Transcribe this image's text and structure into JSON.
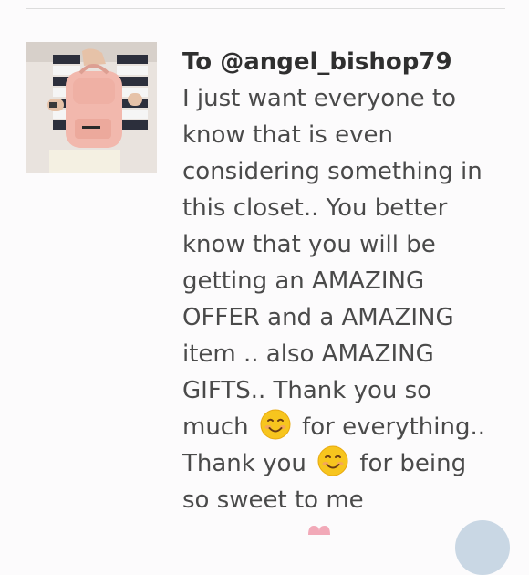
{
  "comment": {
    "author": "To @angel_bishop79",
    "lines": [
      "I just want everyone to",
      "know that is even",
      "considering something in",
      "this closet.. You better",
      "know that you will be",
      "getting an AMAZING",
      "OFFER and a AMAZING",
      "item .. also AMAZING",
      "GIFTS.. Thank you so"
    ],
    "line10_before": "much",
    "line10_after": "for everything..",
    "line11_before": "Thank you",
    "line11_after": "for being",
    "line12": "so sweet to me"
  },
  "icons": {
    "avatar": "profile-photo",
    "emoji": "smiling-face-emoji"
  },
  "colors": {
    "author": "#2f2f2f",
    "text": "#4a4a4a",
    "emoji": "#f7c51e",
    "backpack": "#f2b8ad",
    "corner_button": "#c9d7e4"
  }
}
